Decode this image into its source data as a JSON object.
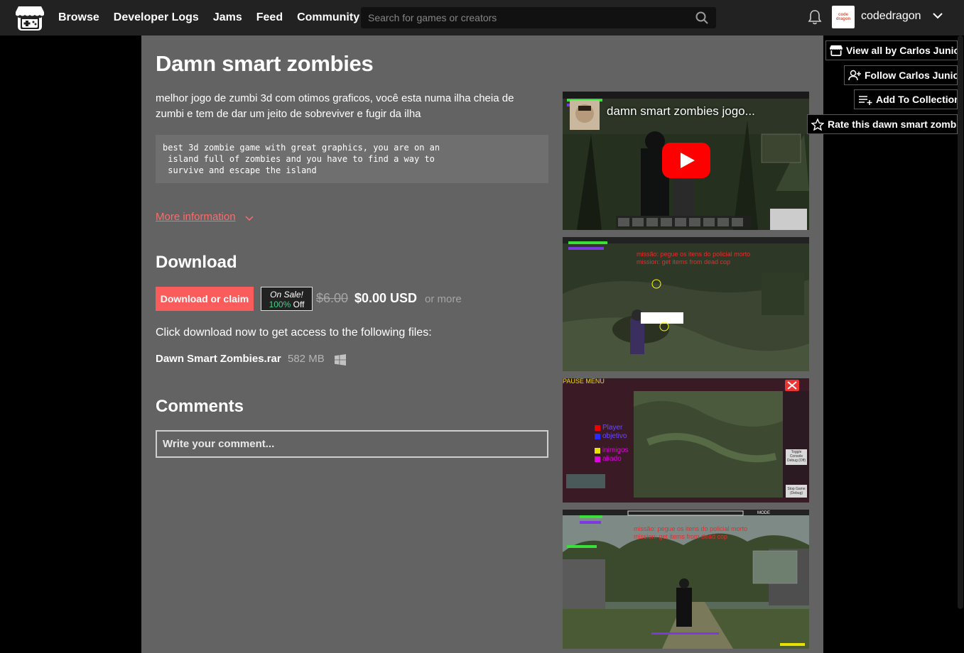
{
  "header": {
    "nav": [
      "Browse",
      "Developer Logs",
      "Jams",
      "Feed",
      "Community"
    ],
    "search_placeholder": "Search for games or creators",
    "username": "codedragon",
    "avatar_text": "code dragon"
  },
  "game": {
    "title": "Damn smart zombies",
    "description": "melhor jogo de  zumbi 3d com otimos graficos, você esta numa ilha cheia de zumbi e tem de dar um jeito de sobreviver e fugir da ilha",
    "code_text": "best 3d zombie game with great graphics, you are on an\n island full of zombies and you have to find a way to\n survive and escape the island",
    "more_info": "More information"
  },
  "download": {
    "heading": "Download",
    "button": "Download or claim",
    "sale_label": "On Sale!",
    "sale_pct": "100%",
    "sale_off": " Off",
    "old_price": "$6.00",
    "new_price": "$0.00 USD",
    "or_more": "or more",
    "files_intro": "Click download now to get access to the following files:",
    "file_name": "Dawn Smart Zombies.rar",
    "file_size": "582 MB"
  },
  "comments": {
    "heading": "Comments",
    "placeholder": "Write your comment..."
  },
  "media": {
    "video_title": "damn smart zombies jogo...",
    "shot1_text_a": "missão: pegue os itens do policial morto",
    "shot1_text_b": "mission: get items from dead cop",
    "shot2_header": "PAUSE MENU",
    "shot2_legend": [
      "Player",
      "objetivo",
      "inimigos",
      "aliado"
    ],
    "shot2_buttons": [
      "Toggle Console Debug (Off)",
      "Stop Game (Debug)"
    ],
    "shot3_text_a": "missão: pegue os itens do policial morto",
    "shot3_text_b": "mission: get items from dead cop",
    "shot3_mode": "MODE"
  },
  "actions": {
    "view_all": "View all by Carlos Junior",
    "follow": "Follow Carlos Junior",
    "collection": "Add To Collection",
    "rate": "Rate this dawn smart zombie"
  },
  "colors": {
    "accent": "#fa5c5c",
    "column_bg": "#636363",
    "header_bg": "#222222",
    "sale_green": "#45d08b",
    "youtube_red": "#ff0000"
  }
}
